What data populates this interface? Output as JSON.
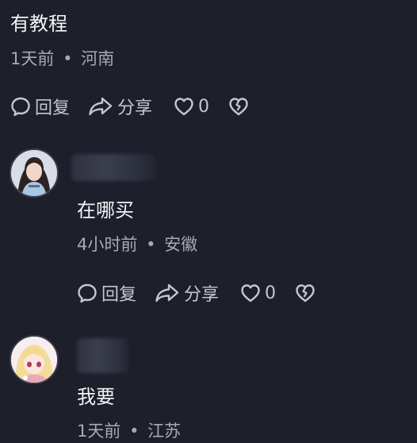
{
  "comments": [
    {
      "text": "有教程",
      "time": "1天前",
      "location": "河南",
      "reply_label": "回复",
      "share_label": "分享",
      "like_count": "0"
    },
    {
      "text": "在哪买",
      "time": "4小时前",
      "location": "安徽",
      "reply_label": "回复",
      "share_label": "分享",
      "like_count": "0"
    },
    {
      "text": "我要",
      "time": "1天前",
      "location": "江苏"
    }
  ],
  "separator": "•",
  "icons": {
    "reply": "speech-bubble-icon",
    "share": "share-arrow-icon",
    "like": "heart-icon",
    "dislike": "broken-heart-icon"
  },
  "colors": {
    "background": "#1d1f2a",
    "text": "#f4f4f6",
    "meta": "#a7a9b3",
    "actions": "#c5c7cf"
  }
}
